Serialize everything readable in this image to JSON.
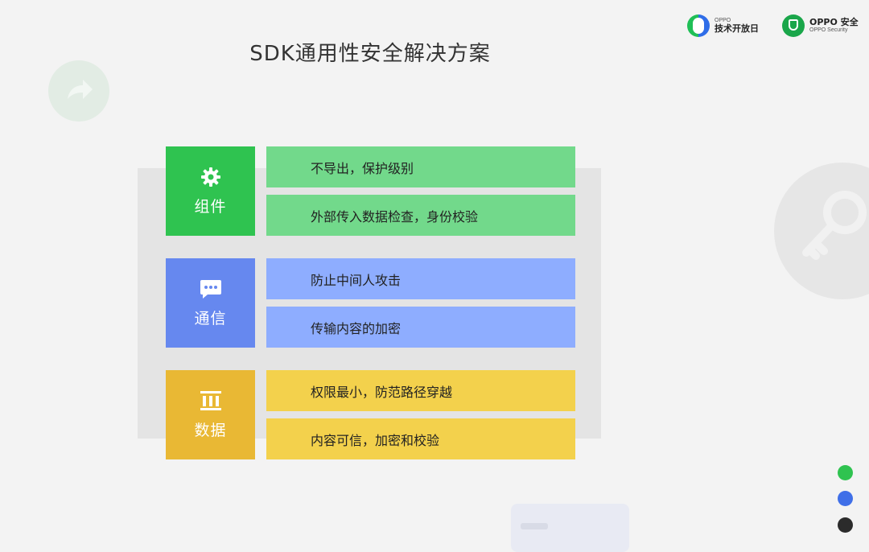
{
  "header": {
    "logo_left": {
      "small": "OPPO",
      "main": "技术开放日"
    },
    "logo_right": {
      "main": "OPPO 安全",
      "small": "OPPO Security"
    }
  },
  "page_title": "SDK通用性安全解决方案",
  "colors": {
    "component": "#2fc350",
    "component_item": "#72d98b",
    "communication": "#6688ef",
    "communication_item": "#8eadff",
    "data": "#e9b834",
    "data_item": "#f3d14c"
  },
  "categories": [
    {
      "label": "组件",
      "icon": "gear-icon",
      "items": [
        "不导出，保护级别",
        "外部传入数据检查，身份校验"
      ]
    },
    {
      "label": "通信",
      "icon": "chat-bubble-icon",
      "items": [
        "防止中间人攻击",
        "传输内容的加密"
      ]
    },
    {
      "label": "数据",
      "icon": "bank-icon",
      "items": [
        "权限最小，防范路径穿越",
        "内容可信，加密和校验"
      ]
    }
  ],
  "nav_dots": [
    "#2fc350",
    "#3f6fe8",
    "#2b2b2b"
  ]
}
